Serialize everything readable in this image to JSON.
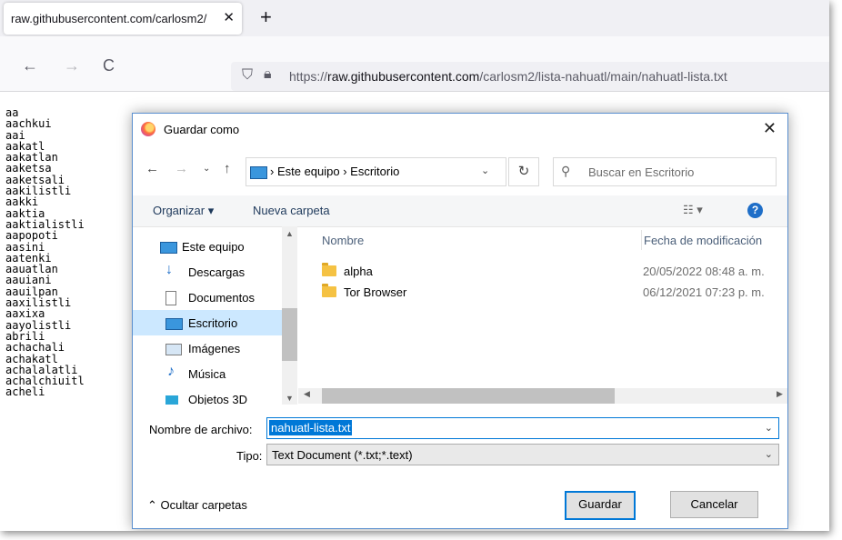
{
  "browser": {
    "tab_title": "raw.githubusercontent.com/carlosm2/",
    "tab_close": "✕",
    "new_tab": "+",
    "back": "←",
    "forward": "→",
    "reload": "C",
    "url_prefix": "https://",
    "url_domain": "raw.githubusercontent.com",
    "url_path": "/carlosm2/lista-nahuatl/main/nahuatl-lista.txt"
  },
  "page": {
    "words": [
      "aa",
      "aachkui",
      "aai",
      "aakatl",
      "aakatlan",
      "aaketsa",
      "aaketsali",
      "aakilistli",
      "aakki",
      "aaktia",
      "aaktialistli",
      "aapopoti",
      "aasini",
      "aatenki",
      "aauatlan",
      "aauiani",
      "aauilpan",
      "aaxilistli",
      "aaxixa",
      "aayolistli",
      "abrili",
      "achachali",
      "achakatl",
      "achalalatli",
      "achalchiuitl",
      "acheli"
    ]
  },
  "dialog": {
    "title": "Guardar como",
    "close": "✕",
    "breadcrumb": "› Este equipo › Escritorio",
    "search_placeholder": "Buscar en Escritorio",
    "organize": "Organizar ▾",
    "new_folder": "Nueva carpeta",
    "help": "?",
    "nav_items": [
      {
        "label": "Este equipo",
        "icon": "computer-icon"
      },
      {
        "label": "Descargas",
        "icon": "download-icon"
      },
      {
        "label": "Documentos",
        "icon": "document-icon"
      },
      {
        "label": "Escritorio",
        "icon": "desktop-icon"
      },
      {
        "label": "Imágenes",
        "icon": "pictures-icon"
      },
      {
        "label": "Música",
        "icon": "music-icon"
      },
      {
        "label": "Objetos 3D",
        "icon": "objects3d-icon"
      }
    ],
    "columns": {
      "name": "Nombre",
      "date": "Fecha de modificación"
    },
    "files": [
      {
        "name": "alpha",
        "date": "20/05/2022 08:48 a. m."
      },
      {
        "name": "Tor Browser",
        "date": "06/12/2021 07:23 p. m."
      }
    ],
    "filename_label": "Nombre de archivo:",
    "filename_value": "nahuatl-lista.txt",
    "type_label": "Tipo:",
    "type_value": "Text Document (*.txt;*.text)",
    "hide_folders": "⌃  Ocultar carpetas",
    "save": "Guardar",
    "cancel": "Cancelar"
  },
  "colors": {
    "accent": "#0078d7",
    "selected_nav": "#cce8ff"
  }
}
